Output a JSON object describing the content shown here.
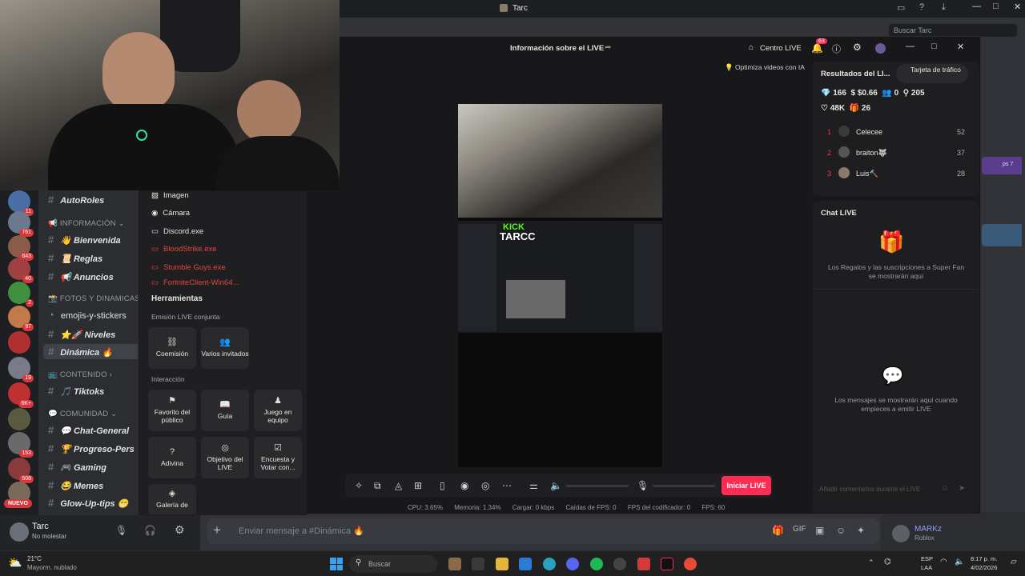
{
  "window": {
    "title": "Tarc",
    "search_placeholder": "Buscar Tarc"
  },
  "discord": {
    "guild_badges": [
      "11",
      "761",
      "643",
      "40",
      "2",
      "97",
      "",
      "19",
      "6K+",
      "",
      "153",
      "508",
      ""
    ],
    "nuevo_label": "NUEVO",
    "categories": {
      "informacion": "INFORMACIÓN",
      "fotos": "FOTOS Y DINAMICAS",
      "contenido": "CONTENIDO",
      "comunidad": "COMUNIDAD"
    },
    "channels": {
      "autoroles": "AutoRoles",
      "bienvenida": "👋 Bienvenida",
      "reglas": "📜 Reglas",
      "anuncios": "📢 Anuncios",
      "emojis": "emojis-y-stickers",
      "niveles": "⭐🚀 Niveles",
      "dinamica": "Dinámica 🔥",
      "tiktoks": "🎵 Tiktoks",
      "chat_general": "💬 Chat-General",
      "progreso": "🏆 Progreso-Pers",
      "gaming": "🎮 Gaming",
      "memes": "😂 Memes",
      "glowup": "Glow-Up-tips 😁"
    },
    "user": {
      "name": "Tarc",
      "status": "No molestar"
    },
    "message_placeholder": "Enviar mensaje a #Dinámica 🔥",
    "right_user": {
      "name": "MARKz",
      "activity": "Roblox"
    },
    "side_tag": "ps 7"
  },
  "tiktok": {
    "header_title": "Información sobre el LIVE",
    "centro_live": "Centro LIVE",
    "notif_count": "63",
    "optimize_label": "Optimiza videos con IA",
    "sources": [
      {
        "label": "Imagen",
        "red": false
      },
      {
        "label": "Cámara",
        "red": false
      },
      {
        "label": "Discord.exe",
        "red": false
      },
      {
        "label": "BloodStrike.exe",
        "red": true
      },
      {
        "label": "Stumble Guys.exe",
        "red": true
      },
      {
        "label": "FortniteClient-Win64...",
        "red": true
      }
    ],
    "tools_title": "Herramientas",
    "section_joint": "Emisión LIVE conjunta",
    "tile_coemision": "Coemisión",
    "tile_varios": "Varios invitados",
    "section_interaction": "Interacción",
    "tile_favorito": "Favorito del público",
    "tile_guia": "Guía",
    "tile_juego": "Juego en equipo",
    "tile_adivina": "Adivina",
    "tile_objetivo": "Objetivo del LIVE",
    "tile_encuesta": "Encuesta y Votar con...",
    "tile_galeria": "Galería de",
    "start_button": "Iniciar LIVE",
    "stats": {
      "cpu": "CPU: 3.65%",
      "memoria": "Memoria: 1.34%",
      "cargar": "Cargar: 0 kbps",
      "caidas": "Caídas de FPS: 0",
      "codificador": "FPS del codificador: 0",
      "fps": "FPS: 60"
    },
    "results_title": "Resultados del LI...",
    "traffic_card": "Tarjeta de tráfico",
    "metrics": {
      "diamonds": "166",
      "money": "$0.66",
      "viewers": "0",
      "followers": "205",
      "likes": "48K",
      "gifts": "26"
    },
    "ranking": [
      {
        "rank": "1",
        "name": "Celecee",
        "score": "52"
      },
      {
        "rank": "2",
        "name": "braiton🐺",
        "score": "37"
      },
      {
        "rank": "3",
        "name": "Luis🔨",
        "score": "28"
      }
    ],
    "chat_title": "Chat LIVE",
    "gifts_text": "Los Regalos y las suscripciones a Super Fan se mostrarán aquí",
    "messages_text": "Los mensajes se mostrarán aquí cuando empieces a emitir LIVE",
    "comment_placeholder": "Añadir comentarios durante el LIVE",
    "preview_channel": "TARCC",
    "preview_kick": "KICK"
  },
  "taskbar": {
    "weather_temp": "21°C",
    "weather_desc": "Mayorm. nublado",
    "search": "Buscar",
    "lang": "ESP",
    "lang2": "LAA",
    "time": "8:17 p. m.",
    "date": "4/02/2026"
  }
}
